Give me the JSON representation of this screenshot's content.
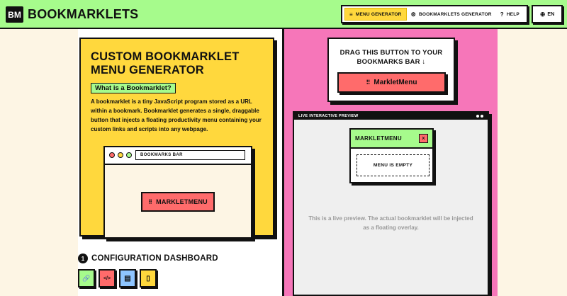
{
  "header": {
    "logo_mark": "BM",
    "logo_text": "BOOKMARKLETS",
    "nav": [
      {
        "icon": "≡",
        "label": "MENU GENERATOR"
      },
      {
        "icon": "⚙",
        "label": "BOOKMARKLETS GENERATOR"
      },
      {
        "icon": "?",
        "label": "HELP"
      }
    ],
    "lang": {
      "icon": "⊕",
      "label": "EN"
    }
  },
  "hero": {
    "title": "CUSTOM BOOKMARKLET MENU GENERATOR",
    "what_button": "What is a Bookmarklet?",
    "description": "A bookmarklet is a tiny JavaScript program stored as a URL within a bookmark. Bookmarklet generates a single, draggable button that injects a floating productivity menu containing your custom links and scripts into any webpage.",
    "browser": {
      "address": "BOOKMARKS BAR",
      "button_icon": "⠿",
      "button_label": "MARKLETMENU"
    }
  },
  "config": {
    "number": "1",
    "title": "CONFIGURATION DASHBOARD",
    "tools": [
      {
        "icon": "🔗",
        "color": "#a6fb8c"
      },
      {
        "icon": "</>",
        "color": "#ff6b6b"
      },
      {
        "icon": "▤",
        "color": "#8ec5ff"
      },
      {
        "icon": "▯",
        "color": "#ffd83d"
      }
    ]
  },
  "drag": {
    "label": "DRAG THIS BUTTON TO YOUR BOOKMARKS BAR ↓",
    "button_icon": "⠿",
    "button_label": "MarkletMenu"
  },
  "preview": {
    "bar_label": "LIVE INTERACTIVE PREVIEW",
    "menu_title": "MARKLETMENU",
    "close": "x",
    "empty": "MENU IS EMPTY",
    "note": "This is a live preview. The actual bookmarklet will be injected as a floating overlay."
  },
  "colors": {
    "green": "#a6fb8c",
    "yellow": "#ffd83d",
    "pink": "#f676b9",
    "red": "#ff6b6b",
    "cream": "#fdf5e4"
  }
}
